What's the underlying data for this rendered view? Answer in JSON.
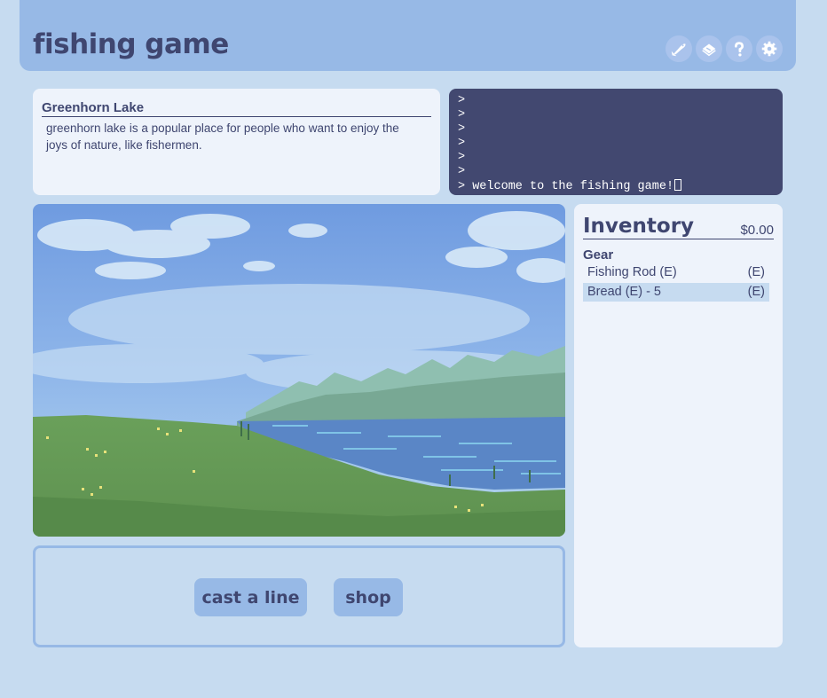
{
  "header": {
    "title": "fishing game"
  },
  "icons": [
    "fish-icon",
    "book-icon",
    "help-icon",
    "settings-icon"
  ],
  "location": {
    "name": "Greenhorn Lake",
    "description": "greenhorn lake is a popular place for people who want to enjoy the joys of nature, like fishermen."
  },
  "console": {
    "lines": [
      ">",
      ">",
      ">",
      ">",
      ">",
      ">",
      "> welcome to the fishing game!"
    ]
  },
  "actions": {
    "cast_label": "cast a line",
    "shop_label": "shop"
  },
  "inventory": {
    "title": "Inventory",
    "money": "$0.00",
    "gear_title": "Gear",
    "items": [
      {
        "name": "Fishing Rod (E)",
        "tag": "(E)",
        "selected": false
      },
      {
        "name": "Bread (E) - 5",
        "tag": "(E)",
        "selected": true
      }
    ]
  },
  "colors": {
    "background": "#c6dbf0",
    "header": "#97b9e6",
    "text": "#3f4670",
    "console_bg": "#424870",
    "panel": "#eef3fb"
  }
}
